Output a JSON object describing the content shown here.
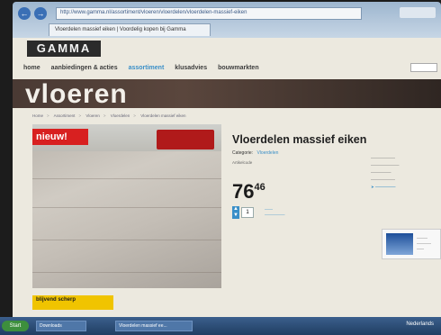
{
  "browser": {
    "address": "http://www.gamma.nl/assortiment/vloeren/vloerdelen/vloerdelen-massief-eiken",
    "tab_title": "Vloerdelen massief eiken | Voordelig kopen bij Gamma"
  },
  "site": {
    "logo": "GAMMA",
    "nav": [
      {
        "label": "home"
      },
      {
        "label": "aanbiedingen & acties"
      },
      {
        "label": "assortiment",
        "active": true
      },
      {
        "label": "klusadvies"
      },
      {
        "label": "bouwmarkten"
      }
    ],
    "banner_title": "vloeren",
    "breadcrumbs": [
      "Home",
      "Assortiment",
      "Vloeren",
      "Vloerdelen",
      "Vloerdelen massief eiken"
    ]
  },
  "product": {
    "badge": "nieuw!",
    "title": "Vloerdelen massief eiken",
    "category_label": "Categorie:",
    "category_value": "Vloerdelen",
    "meta": "Artikelcode",
    "price_main": "76",
    "price_cents": "46",
    "quantity": "1",
    "promo": "blijvend scherp"
  },
  "taskbar": {
    "start": "Start",
    "tasks": [
      "Downloads",
      "Vloerdelen massief ee..."
    ],
    "clock": "Nederlands"
  }
}
